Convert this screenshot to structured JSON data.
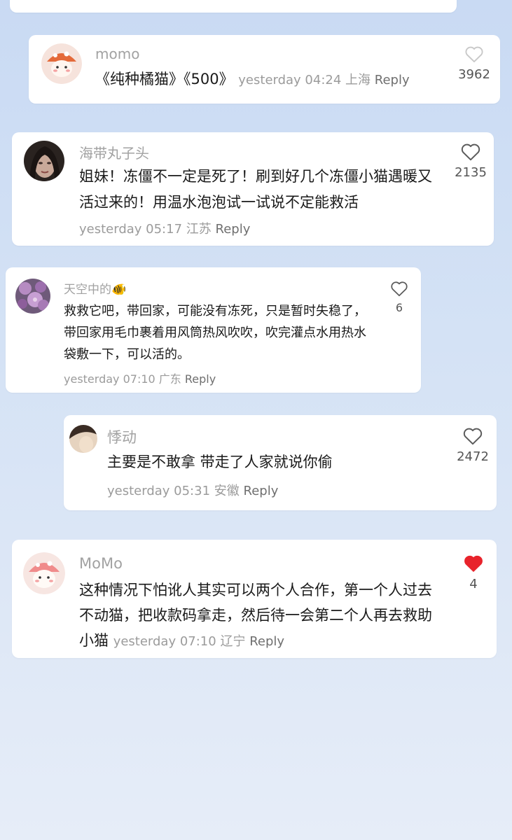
{
  "comments": [
    {
      "username": "momo",
      "text": "《纯种橘猫》《500》",
      "time": "yesterday 04:24",
      "location": "上海",
      "reply_label": "Reply",
      "likes": "3962",
      "liked": false,
      "avatar_icon": "cartoon-mushroom-avatar"
    },
    {
      "username": "海带丸子头",
      "text": "姐妹！冻僵不一定是死了！刷到好几个冻僵小猫遇暖又活过来的！用温水泡泡试一试说不定能救活",
      "time": "yesterday 05:17",
      "location": "江苏",
      "reply_label": "Reply",
      "likes": "2135",
      "liked": false,
      "avatar_icon": "portrait-avatar"
    },
    {
      "username": "天空中的🐠",
      "text": "救救它吧，带回家，可能没有冻死，只是暂时失稳了，带回家用毛巾裹着用风筒热风吹吹，吹完灌点水用热水袋敷一下，可以活的。",
      "time": "yesterday 07:10",
      "location": "广东",
      "reply_label": "Reply",
      "likes": "6",
      "liked": false,
      "avatar_icon": "flower-avatar"
    },
    {
      "username": "悸动",
      "text": "主要是不敢拿 带走了人家就说你偷",
      "time": "yesterday 05:31",
      "location": "安徽",
      "reply_label": "Reply",
      "likes": "2472",
      "liked": false,
      "avatar_icon": "photo-avatar"
    },
    {
      "username": "MoMo",
      "text": "这种情况下怕讹人其实可以两个人合作，第一个人过去不动猫，把收款码拿走，然后待一会第二个人再去救助小猫",
      "time": "yesterday 07:10",
      "location": "辽宁",
      "reply_label": "Reply",
      "likes": "4",
      "liked": true,
      "avatar_icon": "cartoon-mushroom-avatar"
    }
  ],
  "colors": {
    "background_top": "#c9daf3",
    "card": "#ffffff",
    "username": "#a2a2a2",
    "meta": "#9b9b9b",
    "liked_heart": "#e8232b"
  }
}
